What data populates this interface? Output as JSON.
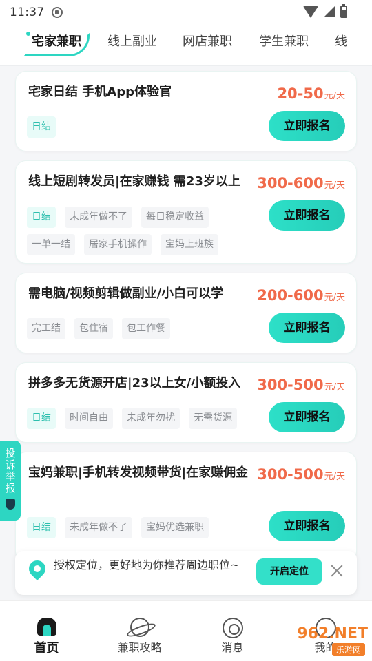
{
  "status_bar": {
    "time": "11:37"
  },
  "tabs": [
    "宅家兼职",
    "线上副业",
    "网店兼职",
    "学生兼职",
    "线"
  ],
  "jobs": [
    {
      "title": "宅家日结 手机App体验官",
      "salary": "20-50",
      "unit": "元/天",
      "tags": [
        "日结"
      ],
      "apply": "立即报名"
    },
    {
      "title": "线上短剧转发员|在家赚钱 需23岁以上",
      "salary": "300-600",
      "unit": "元/天",
      "tags": [
        "日结",
        "未成年做不了",
        "每日稳定收益",
        "一单一结",
        "居家手机操作",
        "宝妈上班族"
      ],
      "apply": "立即报名"
    },
    {
      "title": "需电脑/视频剪辑做副业/小白可以学",
      "salary": "200-600",
      "unit": "元/天",
      "tags": [
        "完工结",
        "包住宿",
        "包工作餐"
      ],
      "apply": "立即报名"
    },
    {
      "title": "拼多多无货源开店|23以上女/小额投入",
      "salary": "300-500",
      "unit": "元/天",
      "tags": [
        "日结",
        "时间自由",
        "未成年勿扰",
        "无需货源"
      ],
      "apply": "立即报名"
    },
    {
      "title": "宝妈兼职|手机转发视频带货|在家赚佣金",
      "salary": "300-500",
      "unit": "元/天",
      "tags": [
        "日结",
        "未成年做不了",
        "宝妈优选兼职"
      ],
      "apply": "立即报名"
    }
  ],
  "report": {
    "label": "投诉举报"
  },
  "location": {
    "text": "授权定位，更好地为你推荐周边职位~",
    "button": "开启定位"
  },
  "bottom_nav": [
    "首页",
    "兼职攻略",
    "消息",
    "我的"
  ],
  "watermark": {
    "brand": "962.NET",
    "sub": "乐游网"
  },
  "colors": {
    "accent": "#2dd6c2",
    "salary": "#f06a4a",
    "tag_accent_bg": "#e8fbf8"
  }
}
